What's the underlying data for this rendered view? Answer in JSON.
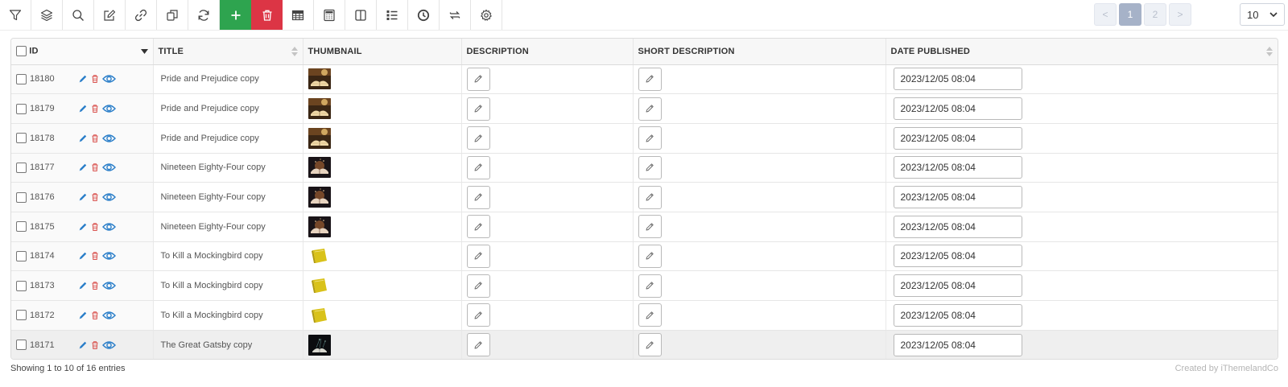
{
  "toolbar": {
    "buttons": [
      {
        "icon": "filter-icon",
        "name": "filter-button"
      },
      {
        "icon": "layers-icon",
        "name": "layers-button"
      },
      {
        "icon": "search-icon",
        "name": "search-button"
      },
      {
        "icon": "edit-icon",
        "name": "bulk-edit-button"
      },
      {
        "icon": "link-icon",
        "name": "link-button"
      },
      {
        "icon": "duplicate-icon",
        "name": "duplicate-button"
      },
      {
        "icon": "refresh-icon",
        "name": "refresh-button"
      },
      {
        "icon": "plus-icon",
        "name": "add-button",
        "color": "#2ea44f"
      },
      {
        "icon": "trash-icon",
        "name": "delete-button",
        "color": "#dc3545"
      },
      {
        "icon": "table-icon",
        "name": "table-button"
      },
      {
        "icon": "calculator-icon",
        "name": "calculator-button"
      },
      {
        "icon": "columns-icon",
        "name": "columns-button"
      },
      {
        "icon": "list-icon",
        "name": "list-button"
      },
      {
        "icon": "history-icon",
        "name": "history-button"
      },
      {
        "icon": "swap-icon",
        "name": "swap-button"
      },
      {
        "icon": "gear-icon",
        "name": "settings-button"
      }
    ]
  },
  "pagination": {
    "prev": "<",
    "pages": [
      "1",
      "2"
    ],
    "active_page": "1",
    "next": ">",
    "per_page": "10"
  },
  "table": {
    "headers": {
      "id": "ID",
      "title": "TITLE",
      "thumbnail": "THUMBNAIL",
      "description": "DESCRIPTION",
      "short_description": "SHORT DESCRIPTION",
      "date_published": "DATE PUBLISHED"
    },
    "rows": [
      {
        "id": "18180",
        "title": "Pride and Prejudice copy",
        "thumb": "book-open-warm",
        "date": "2023/12/05 08:04"
      },
      {
        "id": "18179",
        "title": "Pride and Prejudice copy",
        "thumb": "book-open-warm",
        "date": "2023/12/05 08:04"
      },
      {
        "id": "18178",
        "title": "Pride and Prejudice copy",
        "thumb": "book-open-warm",
        "date": "2023/12/05 08:04"
      },
      {
        "id": "18177",
        "title": "Nineteen Eighty-Four copy",
        "thumb": "book-open-dark",
        "date": "2023/12/05 08:04"
      },
      {
        "id": "18176",
        "title": "Nineteen Eighty-Four copy",
        "thumb": "book-open-dark",
        "date": "2023/12/05 08:04"
      },
      {
        "id": "18175",
        "title": "Nineteen Eighty-Four copy",
        "thumb": "book-open-dark",
        "date": "2023/12/05 08:04"
      },
      {
        "id": "18174",
        "title": "To Kill a Mockingbird copy",
        "thumb": "book-yellow",
        "date": "2023/12/05 08:04"
      },
      {
        "id": "18173",
        "title": "To Kill a Mockingbird copy",
        "thumb": "book-yellow",
        "date": "2023/12/05 08:04"
      },
      {
        "id": "18172",
        "title": "To Kill a Mockingbird copy",
        "thumb": "book-yellow",
        "date": "2023/12/05 08:04"
      },
      {
        "id": "18171",
        "title": "The Great Gatsby copy",
        "thumb": "book-night",
        "date": "2023/12/05 08:04"
      }
    ]
  },
  "footer": {
    "entries": "Showing 1 to 10 of 16 entries",
    "credit": "Created by iThemelandCo"
  },
  "colors": {
    "add": "#2ea44f",
    "delete": "#dc3545",
    "action_blue": "#2a7ec9",
    "action_red": "#d9534f",
    "pager_active": "#a6b2c8"
  }
}
